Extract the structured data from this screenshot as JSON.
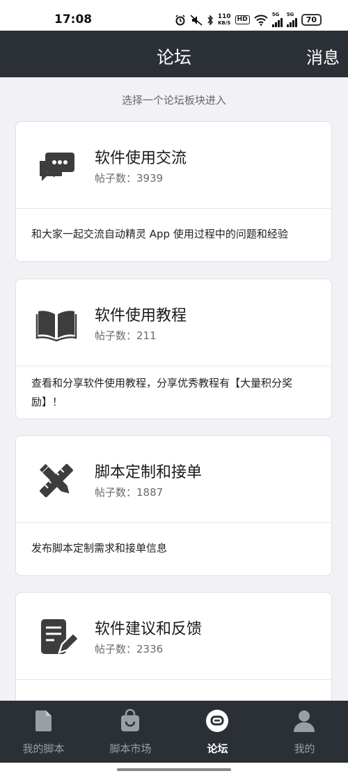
{
  "status_bar": {
    "time": "17:08",
    "net_speed_value": "110",
    "net_speed_unit": "KB/S",
    "hd_badge": "HD",
    "signal_1_label": "5G",
    "signal_2_label": "5G",
    "battery": "70"
  },
  "header": {
    "title": "论坛",
    "messages_label": "消息"
  },
  "main": {
    "prompt": "选择一个论坛板块进入",
    "forums": [
      {
        "title": "软件使用交流",
        "count_label": "帖子数：",
        "count": "3939",
        "description": "和大家一起交流自动精灵 App 使用过程中的问题和经验",
        "icon": "chat-bubbles-icon"
      },
      {
        "title": "软件使用教程",
        "count_label": "帖子数：",
        "count": "211",
        "description": "查看和分享软件使用教程，分享优秀教程有【大量积分奖励】！",
        "icon": "open-book-icon"
      },
      {
        "title": "脚本定制和接单",
        "count_label": "帖子数：",
        "count": "1887",
        "description": "发布脚本定制需求和接单信息",
        "icon": "pencil-ruler-icon"
      },
      {
        "title": "软件建议和反馈",
        "count_label": "帖子数：",
        "count": "2336",
        "description": "",
        "icon": "edit-note-icon"
      }
    ]
  },
  "tab_bar": {
    "tabs": [
      {
        "label": "我的脚本",
        "icon": "document-icon",
        "active": false
      },
      {
        "label": "脚本市场",
        "icon": "shopping-bag-icon",
        "active": false
      },
      {
        "label": "论坛",
        "icon": "chat-icon",
        "active": true
      },
      {
        "label": "我的",
        "icon": "person-icon",
        "active": false
      }
    ]
  },
  "colors": {
    "bar_bg": "#2b2f36",
    "page_bg": "#f2f1f6",
    "icon_gray": "#3d3d3d",
    "tab_inactive": "#9a9ea6"
  }
}
